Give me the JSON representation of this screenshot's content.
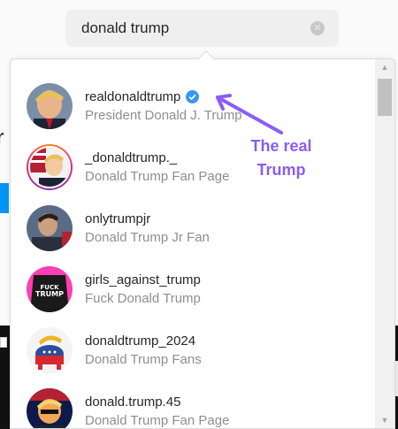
{
  "search": {
    "query": "donald trump",
    "clear_icon": "clear-icon"
  },
  "results": [
    {
      "username": "realdonaldtrump",
      "full_name": "President Donald J. Trump",
      "verified": true,
      "story_ring": false,
      "avatar_colors": [
        "#8a6a58",
        "#e9b48a"
      ]
    },
    {
      "username": "_donaldtrump._",
      "full_name": "Donald Trump Fan Page",
      "verified": false,
      "story_ring": true,
      "avatar_colors": [
        "#b22234",
        "#f3c9a0"
      ]
    },
    {
      "username": "onlytrumpjr",
      "full_name": "Donald Trump Jr Fan",
      "verified": false,
      "story_ring": false,
      "avatar_colors": [
        "#2a2f3c",
        "#c9a080"
      ]
    },
    {
      "username": "girls_against_trump",
      "full_name": "Fuck Donald Trump",
      "verified": false,
      "story_ring": false,
      "avatar_colors": [
        "#ff3fb4",
        "#1a1a1a"
      ],
      "avatar_text": "FUCK TRUMP"
    },
    {
      "username": "donaldtrump_2024",
      "full_name": "Donald Trump Fans",
      "verified": false,
      "story_ring": false,
      "avatar_colors": [
        "#ffffff",
        "#d7282f"
      ]
    },
    {
      "username": "donald.trump.45",
      "full_name": "Donald Trump Fan Page",
      "verified": false,
      "story_ring": false,
      "avatar_colors": [
        "#0d1a4a",
        "#f2a65a"
      ]
    }
  ],
  "annotation": {
    "text": "The real Trump",
    "color": "#8a5cf6"
  },
  "colors": {
    "accent": "#0095f6",
    "verified": "#3897f0"
  }
}
